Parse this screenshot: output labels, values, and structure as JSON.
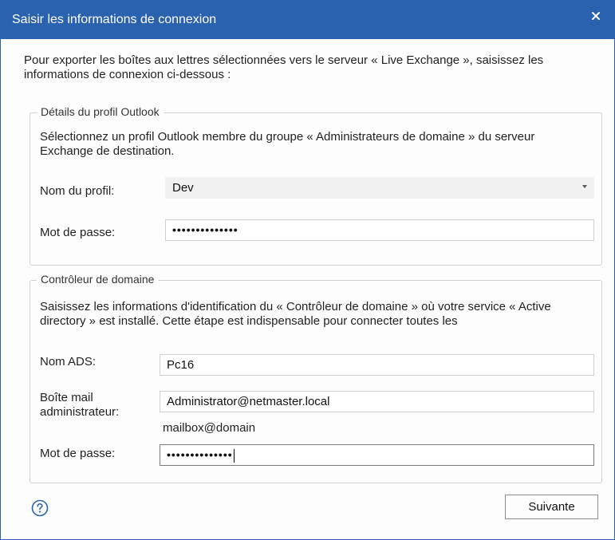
{
  "dialog": {
    "title": "Saisir les informations de connexion",
    "intro": "Pour exporter les boîtes aux lettres sélectionnées vers le serveur « Live Exchange », saisissez les informations de connexion ci-dessous :"
  },
  "outlook_profile": {
    "legend": "Détails du profil Outlook",
    "description": "Sélectionnez un profil Outlook membre du groupe « Administrateurs de domaine » du serveur Exchange de destination.",
    "profile_label": "Nom du profil:",
    "profile_value": "Dev",
    "password_label": "Mot de passe:",
    "password_value": "••••••••••••••"
  },
  "domain_controller": {
    "legend": "Contrôleur de domaine",
    "description": "Saisissez les informations d'identification du « Contrôleur de domaine » où votre service « Active directory » est installé. Cette étape est indispensable pour connecter toutes les",
    "ads_label": "Nom ADS:",
    "ads_value": "Pc16",
    "mailbox_label": "Boîte mail administrateur:",
    "mailbox_value": "Administrator@netmaster.local",
    "mailbox_hint": "mailbox@domain",
    "password_label": "Mot de passe:",
    "password_value": "••••••••••••••"
  },
  "footer": {
    "next_label": "Suivante"
  },
  "colors": {
    "titlebar": "#2b62b0",
    "help_icon": "#2b62b0"
  },
  "icons": [
    "close-icon",
    "help-icon",
    "chevron-down-icon"
  ]
}
